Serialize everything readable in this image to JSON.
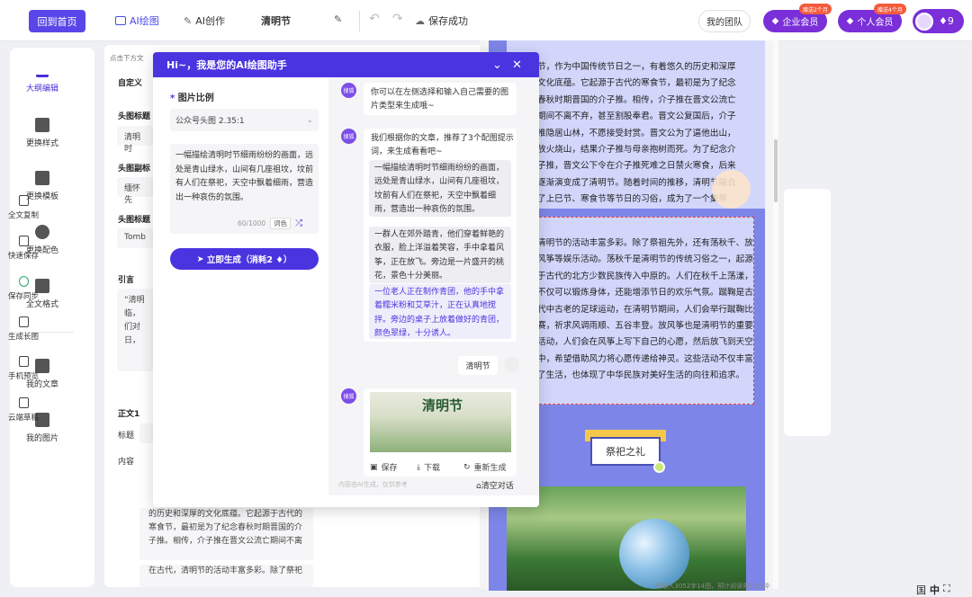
{
  "topbar": {
    "home": "回到首页",
    "ai_draw": "AI绘图",
    "ai_create": "AI创作",
    "doc_title": "清明节",
    "save_status": "保存成功",
    "team": "我的团队",
    "enterprise_vip": "企业会员",
    "personal_vip": "个人会员",
    "enterprise_tag": "赠送2个月",
    "personal_tag": "赠送4个月",
    "points": "9"
  },
  "sidebar": {
    "items": [
      {
        "label": "大纲编辑"
      },
      {
        "label": "更换样式"
      },
      {
        "label": "更换模板"
      },
      {
        "label": "更换配色"
      },
      {
        "label": "全文格式"
      },
      {
        "label": "我的文章"
      },
      {
        "label": "我的图片"
      }
    ]
  },
  "settings": {
    "hint": "点击下方文",
    "custom": "自定义",
    "header_title_lbl": "头图标题",
    "header_title_val": "清明时",
    "header_sub_lbl": "头图副标",
    "header_sub_val": "缅怀先",
    "header_en_lbl": "头图标题",
    "header_en_val": "Tomb",
    "quote_lbl": "引言",
    "quote_l1": "“清明",
    "quote_l2": "临，",
    "quote_l3": "们对",
    "quote_l4": "日，",
    "body_lbl": "正文1",
    "title_lbl": "标题",
    "content_lbl": "内容",
    "p1": "的历史和深厚的文化底蕴。它起源于古代的寒食节，最初是为了纪念春秋时期晋国的介子推。相传，介子推在晋文公流亡期间不离",
    "p2": "在古代，清明节的活动丰富多彩。除了祭祀"
  },
  "article": {
    "p1": "节，作为中国传统节日之一，有着悠久的历史和深厚文化底蕴。它起源于古代的寒食节，最初是为了纪念春秋时期晋国的介子推。相传，介子推在晋文公流亡期间不离不弃，甚至割股奉君。晋文公复国后，介子推隐居山林，不愿接受封赏。晋文公为了逼他出山，放火烧山，结果介子推与母亲抱树而死。为了纪念介子推，晋文公下令在介子推死难之日禁火寒食，后来逐渐演变成了清明节。随着时间的推移，清明节融合了上巳节、寒食节等节日的习俗，成为了一个集祭祀、踏青、游戏等多种活动于一体的综合性节日。",
    "p2": "清明节的活动丰富多彩。除了祭祖先外，还有荡秋千、放风筝等娱乐活动。荡秋千是清明节的传统习俗之一，起源于古代的北方少数民族传入中原的。人们在秋千上荡漾，不仅可以锻炼身体，还能增添节日的欢乐气氛。蹴鞠是古代中古老的足球运动，在清明节期间，人们会举行蹴鞠比赛，祈求风调雨顺、五谷丰登。放风筝也是清明节的重要活动，人们会在风筝上写下自己的心愿，然后放飞到天空中，希望借助风力将心愿传递给神灵。这些活动不仅丰富了生活，也体现了中华民族对美好生活的向往和追求。",
    "section_title": "祭祀之礼",
    "status": "已输入3052字14图，预计阅读需19分钟"
  },
  "rightbar": {
    "items": [
      {
        "label": "全文复制"
      },
      {
        "label": "快速保存"
      },
      {
        "label": "保存同步"
      },
      {
        "label": "生成长图"
      },
      {
        "label": "手机预览"
      },
      {
        "label": "云端草稿"
      }
    ]
  },
  "lang": {
    "a": "国",
    "b": "中"
  },
  "ai_modal": {
    "title": "Hi~，我是您的AI绘图助手",
    "ratio_label": "图片比例",
    "ratio_value": "公众号头图 2.35:1",
    "prompt": "一幅描绘清明时节细雨纷纷的画面，远处是青山绿水，山间有几座祖坟，坟前有人们在祭祀，天空中飘着细雨，营造出一种哀伤的氛围。",
    "char_count": "60/1000",
    "chip_color": "词色",
    "gen_button": "立即生成（消耗2",
    "chat": {
      "bot_label": "搜狐",
      "msg1": "你可以在左侧选择和输入自己需要的图片类型来生成哦~",
      "msg2": "我们根据你的文章，推荐了3个配图提示词，来生成看看吧~",
      "opt1": "一幅描绘清明时节细雨纷纷的画面，远处是青山绿水，山间有几座祖坟，坟前有人们在祭祀，天空中飘着细雨，营造出一种哀伤的氛围。",
      "opt2": "一群人在郊外踏青，他们穿着鲜艳的衣服，脸上洋溢着笑容，手中拿着风筝，正在放飞。旁边是一片盛开的桃花，景色十分美丽。",
      "opt3": "一位老人正在制作青团，他的手中拿着糯米粉和艾草汁，正在认真地搅拌。旁边的桌子上放着做好的青团，颜色翠绿，十分诱人。",
      "user_msg": "清明节",
      "img_title": "清明节",
      "save": "保存",
      "download": "下载",
      "regen": "重新生成",
      "footer": "内容由AI生成，仅供参考",
      "clear": "清空对话"
    }
  }
}
